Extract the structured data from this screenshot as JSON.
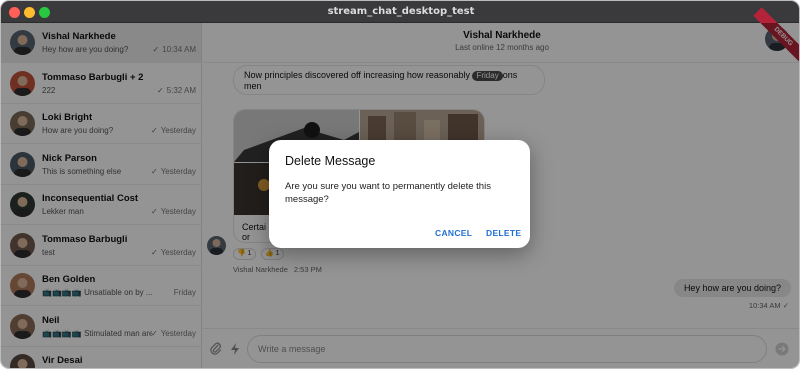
{
  "window": {
    "title": "stream_chat_desktop_test"
  },
  "sidebar": {
    "channels": [
      {
        "name": "Vishal Narkhede",
        "preview": "Hey how are you doing?",
        "time": "10:34 AM",
        "read": true,
        "selected": true,
        "avatar_color": "#5a6470"
      },
      {
        "name": "Tommaso Barbugli + 2",
        "preview": "222",
        "time": "5:32 AM",
        "read": true,
        "selected": false,
        "avatar_color": "#c2533a"
      },
      {
        "name": "Loki Bright",
        "preview": "How are you doing?",
        "time": "Yesterday",
        "read": true,
        "selected": false,
        "avatar_color": "#7c6a58"
      },
      {
        "name": "Nick Parson",
        "preview": "This is something else",
        "time": "Yesterday",
        "read": true,
        "selected": false,
        "avatar_color": "#4d5a66"
      },
      {
        "name": "Inconsequential Cost",
        "preview": "Lekker man",
        "time": "Yesterday",
        "read": true,
        "selected": false,
        "avatar_color": "#2f3a33"
      },
      {
        "name": "Tommaso Barbugli",
        "preview": "test",
        "time": "Yesterday",
        "read": true,
        "selected": false,
        "avatar_color": "#6e5b4e"
      },
      {
        "name": "Ben Golden",
        "preview": "📺📺📺📺 Unsatiable on by ...",
        "time": "Friday",
        "read": false,
        "selected": false,
        "avatar_color": "#b07a5c"
      },
      {
        "name": "Neil",
        "preview": "📺📺📺📺 Stimulated man are ...",
        "time": "Yesterday",
        "read": true,
        "selected": false,
        "avatar_color": "#8a6b56"
      },
      {
        "name": "Vir Desai",
        "preview": "",
        "time": "",
        "read": false,
        "selected": false,
        "avatar_color": "#5b4a44"
      }
    ]
  },
  "chat": {
    "header": {
      "title": "Vishal Narkhede",
      "subtitle": "Last online 12 months ago",
      "debug_label": "DEBUG"
    },
    "messages": {
      "first_text_before": "Now principles discovered off increasing how reasonably ",
      "date_separator": "Friday",
      "first_text_after": "ons men",
      "gallery_caption": "Certai",
      "gallery_caption_line2": "or",
      "reactions": [
        {
          "icon": "👎",
          "count": "1"
        },
        {
          "icon": "👍",
          "count": "1"
        }
      ],
      "sender": "Vishal Narkhede",
      "sender_time": "2:53 PM",
      "own_text": "Hey how are you doing?",
      "own_time": "10:34 AM"
    },
    "composer": {
      "placeholder": "Write a message"
    }
  },
  "dialog": {
    "title": "Delete Message",
    "body": "Are you sure you want to permanently delete this message?",
    "cancel_label": "CANCEL",
    "delete_label": "DELETE"
  },
  "colors": {
    "accent": "#1f6ed4",
    "debug_ribbon": "#b4233a",
    "titlebar": "#3a3a3c"
  }
}
